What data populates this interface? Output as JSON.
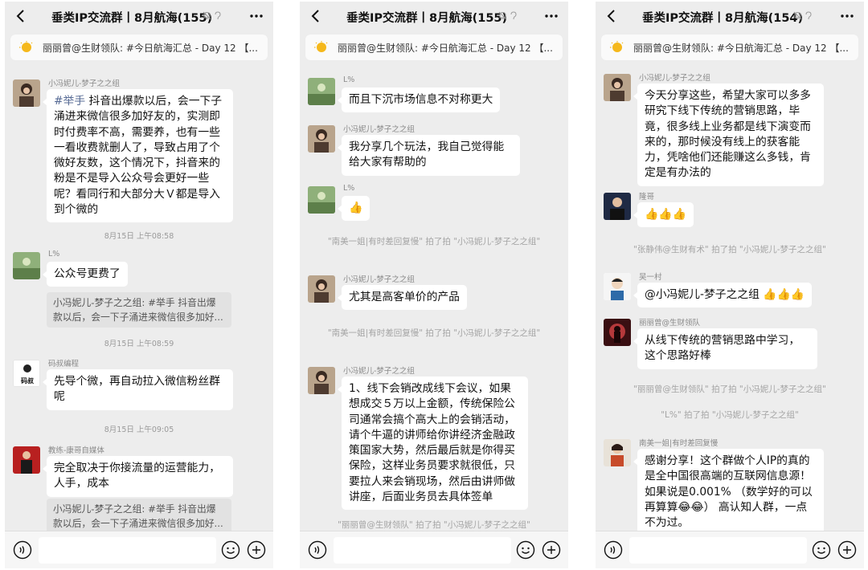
{
  "panels": [
    {
      "title": "垂类IP交流群丨8月航海(155)",
      "announcement": "丽丽曾@生财领队: #今日航海汇总 - Day 12 【...",
      "chat": {
        "m1_sender": "小冯妮儿-梦子之之组",
        "m1_hashtag": "#举手",
        "m1_text": " 抖音出爆款以后，会一下子涌进来微信很多加好友的，实测即时付费率不高，需要养，也有一些一看收费就删人了，导致占用了个微好友数，这个情况下，抖音来的粉是不是导入公众号会更好一些呢？看同行和大部分大Ｖ都是导入到个微的",
        "t1": "8月15日 上午08:58",
        "m2_sender": "L%",
        "m2_text": "公众号更费了",
        "m2_quote": "小冯妮儿-梦子之之组: #举手 抖音出爆款以后，会一下子涌进来微信很多加好...",
        "t2": "8月15日 上午08:59",
        "m3_sender": "码叔编程",
        "m3_avatar_text": "码叔",
        "m3_text": "先导个微，再自动拉入微信粉丝群呢",
        "t3": "8月15日 上午09:05",
        "m4_sender": "教练-康哥自媒体",
        "m4_text": "完全取决于你接流量的运营能力，人手，成本",
        "m4_quote": "小冯妮儿-梦子之之组: #举手 抖音出爆款以后，会一下子涌进来微信很多加好..."
      }
    },
    {
      "title": "垂类IP交流群丨8月航海(155)",
      "announcement": "丽丽曾@生财领队: #今日航海汇总 - Day 12 【...",
      "chat": {
        "m1_sender": "L%",
        "m1_text": "而且下沉市场信息不对称更大",
        "m2_sender": "小冯妮儿-梦子之之组",
        "m2_text": "我分享几个玩法，我自己觉得能给大家有帮助的",
        "m3_sender": "L%",
        "m3_emoji": "👍",
        "sys1": "\"南美一姐|有时差回复慢\" 拍了拍 \"小冯妮儿-梦子之之组\"",
        "m4_sender": "小冯妮儿-梦子之之组",
        "m4_text": "尤其是高客单价的产品",
        "sys2": "\"南美一姐|有时差回复慢\" 拍了拍 \"小冯妮儿-梦子之之组\"",
        "m5_sender": "小冯妮儿-梦子之之组",
        "m5_text": "1、线下会销改成线下会议，如果想成交５万以上金额，传统保险公司通常会搞个高大上的会销活动，请个牛逼的讲师给你讲经济金融政策国家大势，然后最后就是你得买保险，这样业务员要求就很低，只要拉人来会销现场，然后由讲师做讲座，后面业务员去具体签单",
        "sys3": "\"丽丽曾@生财领队\" 拍了拍 \"小冯妮儿-梦子之之组\""
      }
    },
    {
      "title": "垂类IP交流群丨8月航海(154)",
      "announcement": "丽丽曾@生财领队: #今日航海汇总 - Day 12 【...",
      "chat": {
        "m1_sender": "小冯妮儿-梦子之之组",
        "m1_text": "今天分享这些，希望大家可以多多研究下线下传统的营销思路，毕竟，很多线上业务都是线下演变而来的，那时候没有线上的获客能力，凭啥他们还能赚这么多钱，肯定是有办法的",
        "m2_sender": "隆哥",
        "m2_emoji": "👍👍👍",
        "sys1": "\"张静伟@生财有术\" 拍了拍 \"小冯妮儿-梦子之之组\"",
        "m3_sender": "吴一村",
        "m3_text": "@小冯妮儿-梦子之之组 👍👍👍",
        "m4_sender": "丽丽曾@生财领队",
        "m4_text": "从线下传统的营销思路中学习，这个思路好棒",
        "sys2": "\"丽丽曾@生财领队\" 拍了拍 \"小冯妮儿-梦子之之组\"",
        "sys3": "\"L%\" 拍了拍 \"小冯妮儿-梦子之之组\"",
        "m5_sender": "南美一姐|有时差回复慢",
        "m5_text": "感谢分享！这个群做个人IP的真的是全中国很高端的互联网信息源！ 如果说是0.001% （数学好的可以再算算😂😂） 高认知人群，一点不为过。"
      }
    }
  ],
  "colors": {
    "background": "#ededed",
    "bubble": "#ffffff",
    "link": "#576b95",
    "meta_text": "#9a9a9a"
  }
}
